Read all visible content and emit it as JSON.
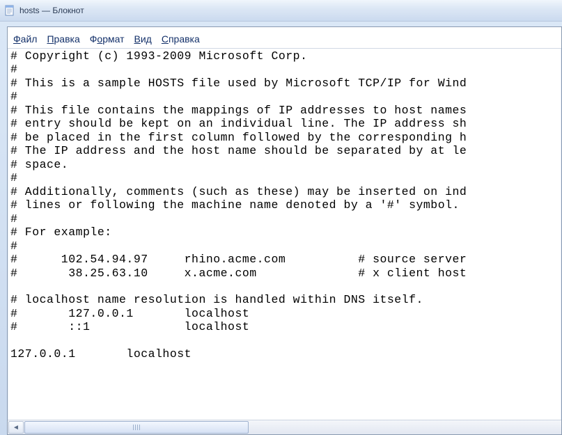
{
  "window": {
    "title": "hosts — Блокнот"
  },
  "menu": {
    "file": {
      "mn": "Ф",
      "rest": "айл"
    },
    "edit": {
      "mn": "П",
      "rest": "равка"
    },
    "format": {
      "mn": "о",
      "pre": "Ф",
      "rest": "рмат"
    },
    "view": {
      "mn": "В",
      "rest": "ид"
    },
    "help": {
      "mn": "С",
      "rest": "правка"
    }
  },
  "content": "# Copyright (c) 1993-2009 Microsoft Corp.\n#\n# This is a sample HOSTS file used by Microsoft TCP/IP for Wind\n#\n# This file contains the mappings of IP addresses to host names\n# entry should be kept on an individual line. The IP address sh\n# be placed in the first column followed by the corresponding h\n# The IP address and the host name should be separated by at le\n# space.\n#\n# Additionally, comments (such as these) may be inserted on ind\n# lines or following the machine name denoted by a '#' symbol.\n#\n# For example:\n#\n#      102.54.94.97     rhino.acme.com          # source server\n#       38.25.63.10     x.acme.com              # x client host\n\n# localhost name resolution is handled within DNS itself.\n#       127.0.0.1       localhost\n#       ::1             localhost\n\n127.0.0.1       localhost"
}
